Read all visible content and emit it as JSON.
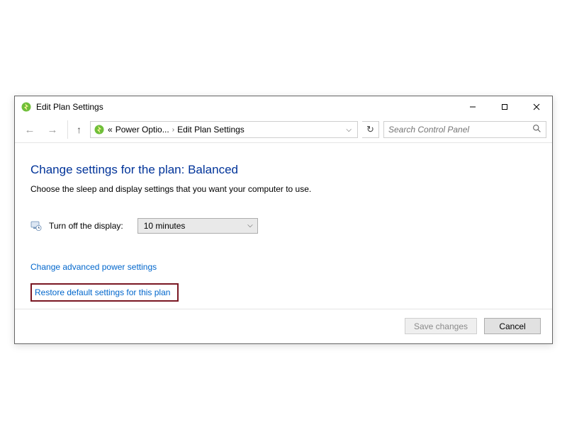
{
  "window": {
    "title": "Edit Plan Settings"
  },
  "nav": {
    "breadcrumb": {
      "prefix": "«",
      "segment1": "Power Optio...",
      "segment2": "Edit Plan Settings"
    },
    "search_placeholder": "Search Control Panel"
  },
  "page": {
    "heading": "Change settings for the plan: Balanced",
    "subtext": "Choose the sleep and display settings that you want your computer to use."
  },
  "display": {
    "label": "Turn off the display:",
    "value": "10 minutes"
  },
  "links": {
    "advanced": "Change advanced power settings",
    "restore": "Restore default settings for this plan"
  },
  "buttons": {
    "save": "Save changes",
    "cancel": "Cancel"
  }
}
